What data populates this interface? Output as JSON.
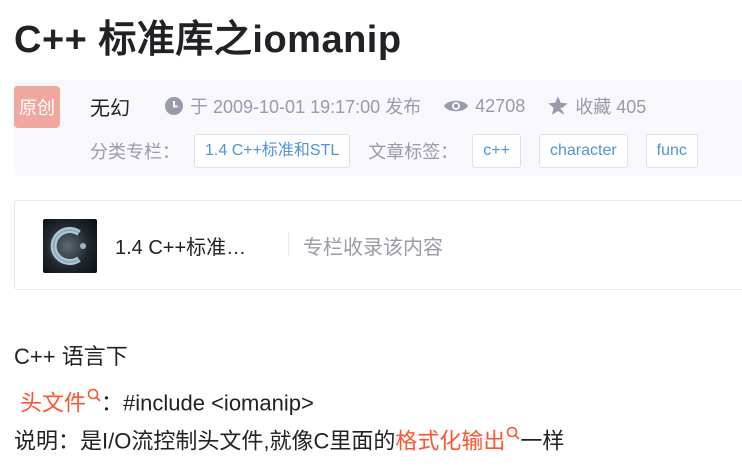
{
  "article": {
    "title": "C++ 标准库之iomanip",
    "badge": "原创",
    "author": "无幻",
    "publish": "于 2009-10-01 19:17:00 发布",
    "views": "42708",
    "favorite": "收藏 405",
    "category_label": "分类专栏：",
    "category": "1.4 C++标准和STL",
    "tags_label": "文章标签：",
    "tags": [
      "c++",
      "character",
      "func"
    ]
  },
  "column_card": {
    "title": "1.4 C++标准…",
    "note": "专栏收录该内容"
  },
  "content": {
    "line1": "C++ 语言下",
    "line2_link": "头文件",
    "line2_rest": "：#include <iomanip>",
    "line3_prefix": "说明：是I/O流控制头文件,就像C里面的",
    "line3_link": "格式化输出",
    "line3_suffix": "一样"
  },
  "colors": {
    "accent_link": "#fc5531",
    "tag_text": "#5094d5",
    "badge_bg": "#f0a79d",
    "meta_text": "#999aaa"
  }
}
